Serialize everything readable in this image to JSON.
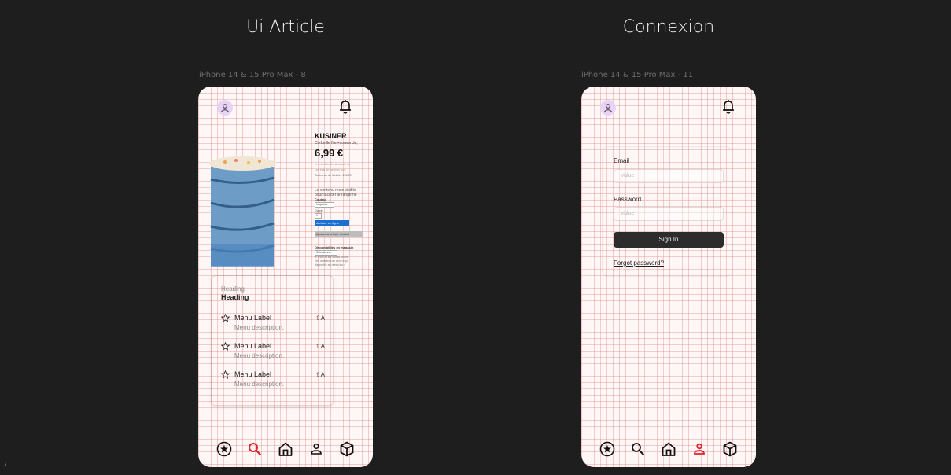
{
  "canvas": {
    "frames": [
      {
        "title": "Ui Article",
        "label": "iPhone 14 & 15 Pro Max - 8"
      },
      {
        "title": "Connexion",
        "label": "iPhone 14 & 15 Pro Max - 11"
      }
    ],
    "edge_mark": "/"
  },
  "article": {
    "product": {
      "name": "KUSINER",
      "subtitle": "Corbeille filet+couvercle,",
      "price": "6,99 €",
      "faint_line": "Le prix définitif est calculé au",
      "faint_line2": "Les frais de livraison sont",
      "reference": "Référence de l'article : 205.73",
      "description_1": "Le contenu reste visible",
      "description_2": "pour faciliter le rangeme",
      "color_label": "Couleur",
      "color_value": "turquoise",
      "qty_label": "Quant",
      "qty_value": "1",
      "online_button": "Acheter en ligne",
      "wishlist_button": "Ajouter à la liste d'achat",
      "availability_title": "Disponibilités en magasin",
      "availability_value": "Sélectionner",
      "availability_line_1": "le choix et les stocks peuve",
      "availability_line_2": "être différents de ceux expo",
      "availability_line_3": "disponible au retrait sur s"
    },
    "menu": {
      "heading_small": "Heading",
      "heading": "Heading",
      "items": [
        {
          "label": "Menu Label",
          "description": "Menu description.",
          "shortcut": "⇧A"
        },
        {
          "label": "Menu Label",
          "description": "Menu description.",
          "shortcut": "⇧A"
        },
        {
          "label": "Menu Label",
          "description": "Menu description.",
          "shortcut": "⇧A"
        }
      ]
    },
    "nav_active": "search"
  },
  "login": {
    "email_label": "Email",
    "email_placeholder": "Value",
    "password_label": "Password",
    "password_placeholder": "Value",
    "sign_in": "Sign In",
    "forgot": "Forgot password?",
    "nav_active": "profile"
  },
  "icons": {
    "top": [
      "user-avatar-icon",
      "bell-icon"
    ],
    "nav": [
      "star-circle-icon",
      "search-icon",
      "home-icon",
      "profile-icon",
      "box-icon"
    ]
  },
  "colors": {
    "background": "#1e1e1e",
    "active_nav": "#e0242b",
    "avatar_bg": "#e8d3f7",
    "button_dark": "#2c2c2c",
    "button_blue": "#1a6fd1"
  }
}
